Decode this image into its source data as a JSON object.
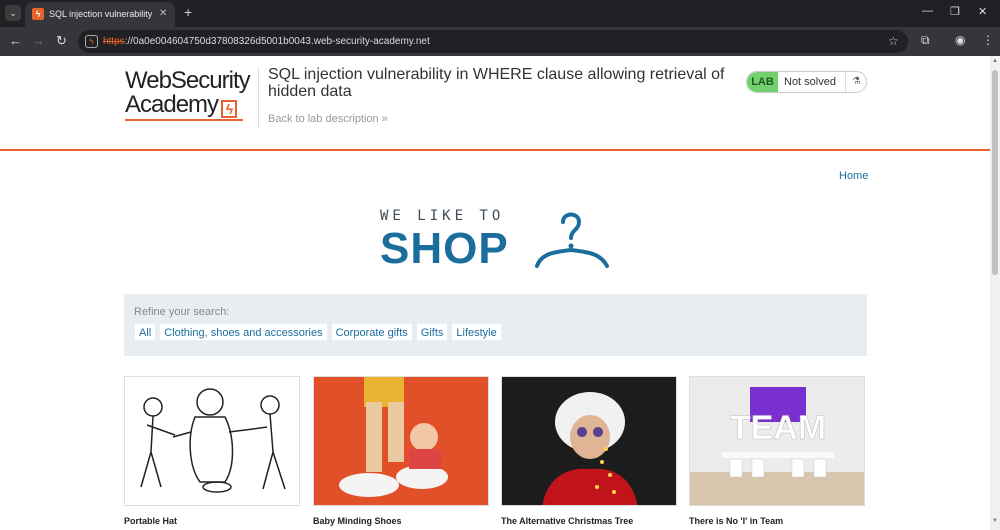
{
  "browser": {
    "tab_title": "SQL injection vulnerability in W",
    "url_scheme": "https",
    "url_rest": "://0a0e004604750d37808326d5001b0043.web-security-academy.net"
  },
  "lab": {
    "logo_line1": "WebSecurity",
    "logo_line2": "Academy",
    "title": "SQL injection vulnerability in WHERE clause allowing retrieval of hidden data",
    "back_link": "Back to lab description",
    "status_badge": "LAB",
    "status_text": "Not solved"
  },
  "nav": {
    "home": "Home"
  },
  "banner": {
    "top": "WE LIKE TO",
    "main": "SHOP"
  },
  "refine": {
    "label": "Refine your search:",
    "filters": [
      "All",
      "Clothing, shoes and accessories",
      "Corporate gifts",
      "Gifts",
      "Lifestyle"
    ]
  },
  "products": [
    {
      "name": "Portable Hat"
    },
    {
      "name": "Baby Minding Shoes"
    },
    {
      "name": "The Alternative Christmas Tree"
    },
    {
      "name": "There is No 'I' in Team",
      "image_text": "TEAM"
    }
  ],
  "colors": {
    "accent": "#e8622c",
    "link": "#1b6d9e",
    "lab_badge": "#70d16d"
  }
}
